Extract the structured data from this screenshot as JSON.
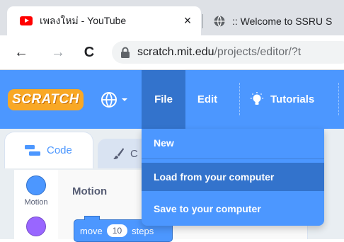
{
  "browser": {
    "tabs": [
      {
        "title": "เพลงใหม่ - YouTube",
        "close": "×",
        "icon": "youtube-icon"
      },
      {
        "title": ":: Welcome to SSRU S",
        "icon": "globe-icon"
      }
    ],
    "url": {
      "host": "scratch.mit.edu",
      "path": "/projects/editor/?t"
    },
    "nav": {
      "back": "←",
      "forward": "→",
      "reload": "C"
    }
  },
  "scratch": {
    "logo": "SCRATCH",
    "menu": {
      "file": "File",
      "edit": "Edit",
      "tutorials": "Tutorials"
    },
    "file_menu": [
      "New",
      "Load from your computer",
      "Save to your computer"
    ],
    "tabs": {
      "code": "Code",
      "costumes": "C"
    },
    "categories": [
      {
        "label": "Motion",
        "color": "#4c97ff"
      },
      {
        "label": "",
        "color": "#9966ff"
      }
    ],
    "palette": {
      "title": "Motion",
      "block": {
        "text": "move",
        "value": "10",
        "suffix": "steps"
      }
    }
  },
  "colors": {
    "menubar": "#4c97ff",
    "menu_active": "#3373cc",
    "motion": "#4c97ff",
    "looks": "#9966ff"
  }
}
